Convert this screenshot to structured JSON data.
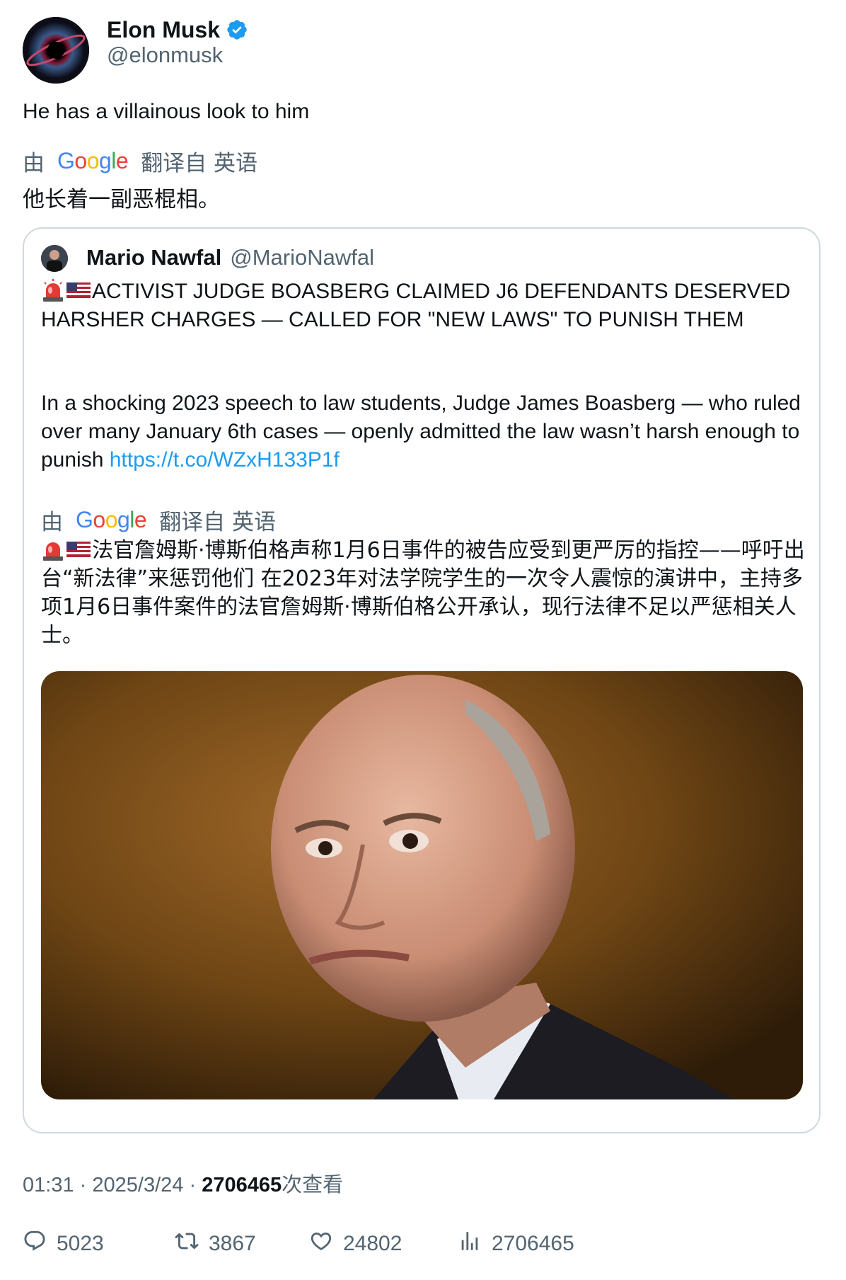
{
  "tweet": {
    "author": {
      "name": "Elon Musk",
      "handle": "@elonmusk"
    },
    "text": "He has a villainous look to him",
    "translation": {
      "by": "由",
      "provider": "Google",
      "from": "翻译自 英语",
      "text": "他长着一副恶棍相。"
    }
  },
  "quoted": {
    "author": {
      "name": "Mario Nawfal",
      "handle": "@MarioNawfal"
    },
    "headline": "ACTIVIST JUDGE BOASBERG CLAIMED J6 DEFENDANTS DESERVED HARSHER CHARGES — CALLED FOR \"NEW LAWS\" TO PUNISH THEM",
    "paragraph": "In a shocking 2023 speech to law students, Judge James Boasberg — who ruled over many January 6th cases — openly admitted the law wasn’t harsh enough to punish",
    "link": "https://t.co/WZxH133P1f",
    "translation": {
      "by": "由",
      "provider": "Google",
      "from": "翻译自 英语",
      "text": "法官詹姆斯·博斯伯格声称1月6日事件的被告应受到更严厉的指控——呼吁出台“新法律”来惩罚他们 在2023年对法学院学生的一次令人震惊的演讲中，主持多项1月6日事件案件的法官詹姆斯·博斯伯格公开承认，现行法律不足以严惩相关人士。"
    }
  },
  "meta": {
    "time": "01:31",
    "sep": "·",
    "date": "2025/3/24",
    "views": "2706465",
    "views_word": "次查看"
  },
  "actions": {
    "replies": "5023",
    "retweets": "3867",
    "likes": "24802",
    "views": "2706465"
  },
  "colors": {
    "link": "#1d9bf0",
    "muted": "#536471",
    "text": "#0f1419",
    "verified": "#1d9bf0"
  },
  "icons": [
    "verified-badge-icon",
    "siren-emoji-icon",
    "us-flag-emoji-icon",
    "reply-icon",
    "retweet-icon",
    "like-icon",
    "views-icon"
  ]
}
